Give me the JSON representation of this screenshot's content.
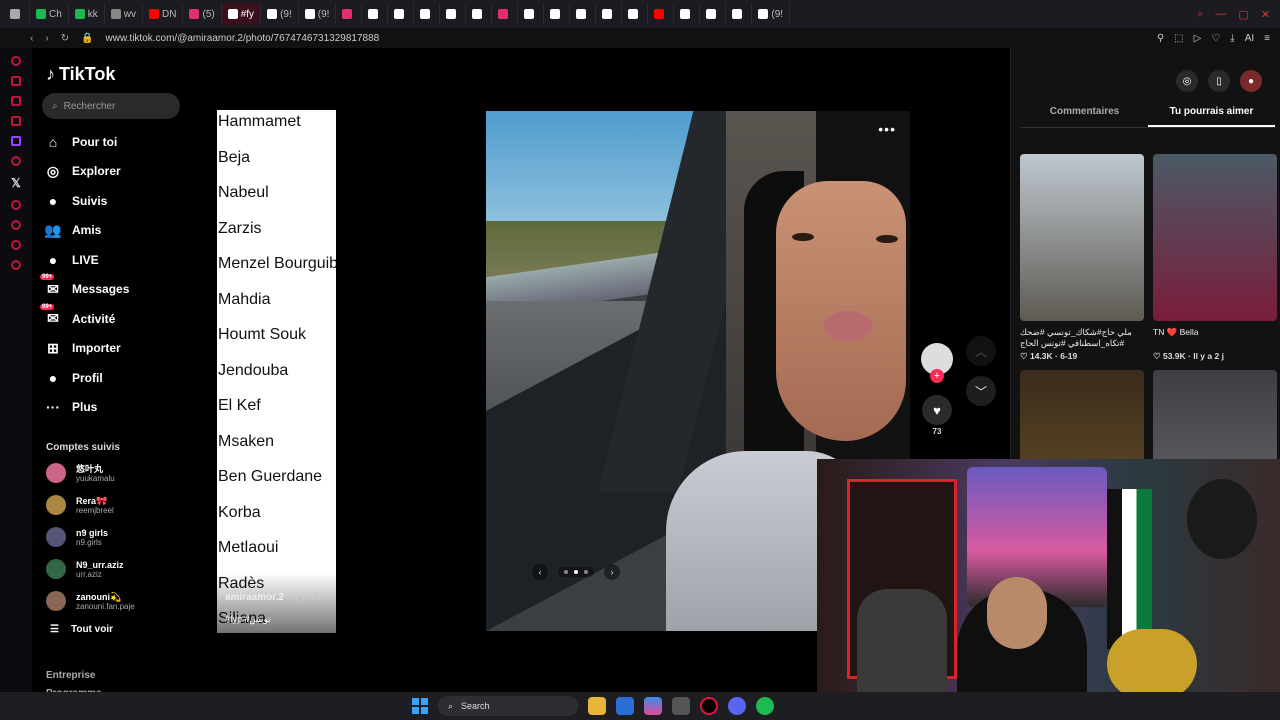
{
  "browser": {
    "tabs": [
      {
        "label": "",
        "color": "#aaaaaa"
      },
      {
        "label": "Ch",
        "color": "#1db954"
      },
      {
        "label": "kk",
        "color": "#1db954"
      },
      {
        "label": "wv",
        "color": "#888888"
      },
      {
        "label": "DN",
        "color": "#ff0000"
      },
      {
        "label": "(5)",
        "color": "#e1306c"
      },
      {
        "label": "#fy",
        "color": "#ffffff",
        "active": true
      },
      {
        "label": "(9!",
        "color": "#ffffff"
      },
      {
        "label": "(9!",
        "color": "#ffffff"
      },
      {
        "label": "",
        "color": "#e1306c"
      },
      {
        "label": "",
        "color": "#ffffff"
      },
      {
        "label": "",
        "color": "#ffffff"
      },
      {
        "label": "",
        "color": "#ffffff"
      },
      {
        "label": "",
        "color": "#ffffff"
      },
      {
        "label": "",
        "color": "#ffffff"
      },
      {
        "label": "",
        "color": "#e1306c"
      },
      {
        "label": "",
        "color": "#ffffff"
      },
      {
        "label": "",
        "color": "#ffffff"
      },
      {
        "label": "",
        "color": "#ffffff"
      },
      {
        "label": "",
        "color": "#ffffff"
      },
      {
        "label": "",
        "color": "#ffffff"
      },
      {
        "label": "",
        "color": "#ff0000"
      },
      {
        "label": "",
        "color": "#ffffff"
      },
      {
        "label": "",
        "color": "#ffffff"
      },
      {
        "label": "",
        "color": "#ffffff"
      },
      {
        "label": "(9!",
        "color": "#ffffff"
      }
    ],
    "url": "www.tiktok.com/@amiraamor.2/photo/7674746731329817888",
    "url_right_label": "AI"
  },
  "tiktok": {
    "logo": "TikTok",
    "search_placeholder": "Rechercher",
    "nav": [
      {
        "label": "Pour toi",
        "icon": "home-icon",
        "glyph": "⌂"
      },
      {
        "label": "Explorer",
        "icon": "compass-icon",
        "glyph": "◎"
      },
      {
        "label": "Suivis",
        "icon": "following-icon",
        "glyph": "●"
      },
      {
        "label": "Amis",
        "icon": "friends-icon",
        "glyph": "👥"
      },
      {
        "label": "LIVE",
        "icon": "live-icon",
        "glyph": "●"
      },
      {
        "label": "Messages",
        "icon": "messages-icon",
        "glyph": "✉",
        "badge": "99+"
      },
      {
        "label": "Activité",
        "icon": "activity-icon",
        "glyph": "✉",
        "badge": "99+"
      },
      {
        "label": "Importer",
        "icon": "upload-icon",
        "glyph": "⊞"
      },
      {
        "label": "Profil",
        "icon": "profile-icon",
        "glyph": "●"
      },
      {
        "label": "Plus",
        "icon": "more-icon",
        "glyph": "···"
      }
    ],
    "followed_title": "Comptes suivis",
    "followed": [
      {
        "name": "悠叶丸",
        "handle": "yuukamalu"
      },
      {
        "name": "Rera🎀",
        "handle": "reemjbreel"
      },
      {
        "name": "n9 girls",
        "handle": "n9.girls"
      },
      {
        "name": "N9_urr.aziz",
        "handle": "urr.aziz"
      },
      {
        "name": "zanouni💫",
        "handle": "zanouni.fan.paje"
      }
    ],
    "see_all": "Tout voir",
    "footer": [
      "Entreprise",
      "Programme"
    ]
  },
  "post": {
    "cities": [
      "Hammamet",
      "Beja",
      "Nabeul",
      "Zarzis",
      "Menzel Bourguiba",
      "Mahdia",
      "Houmt Souk",
      "Jendouba",
      "El Kef",
      "Msaken",
      "Ben Guerdane",
      "Korba",
      "Metlaoui",
      "Radès",
      "Siliana"
    ],
    "author": "amiraamor.2",
    "time": "· Il y a 2 h",
    "hashtags": "#fyp #تونس",
    "likes": "73",
    "carousel_dots": 3,
    "carousel_active": 1
  },
  "right_panel": {
    "tabs": [
      "Commentaires",
      "Tu pourrais aimer"
    ],
    "active_tab": 1,
    "cards": [
      {
        "desc": "ملي حاج#شكاك_تونسي #ضحك #تكاه_اسطنافي #تونس الحاج التونسي",
        "meta": "♡ 14.3K · 6-19"
      },
      {
        "desc": "TN ❤️ Bella",
        "meta": "♡ 53.9K · Il y a 2 j"
      },
      {
        "desc": "",
        "meta": ""
      },
      {
        "desc": "",
        "meta": ""
      }
    ]
  },
  "taskbar": {
    "search_label": "Search"
  }
}
